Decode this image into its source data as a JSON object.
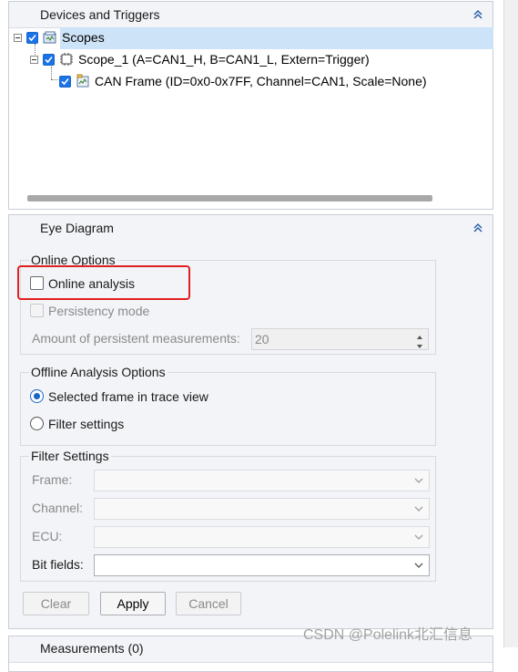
{
  "devices_panel": {
    "title": "Devices and Triggers",
    "tree": {
      "root_label": "Scopes",
      "scope_label": "Scope_1 (A=CAN1_H, B=CAN1_L, Extern=Trigger)",
      "frame_label": "CAN Frame (ID=0x0-0x7FF, Channel=CAN1, Scale=None)"
    }
  },
  "eye_panel": {
    "title": "Eye Diagram",
    "online": {
      "group_label": "Online Options",
      "online_analysis_label": "Online analysis",
      "persistency_label": "Persistency mode",
      "amount_label": "Amount of persistent measurements:",
      "amount_value": "20"
    },
    "offline": {
      "group_label": "Offline Analysis Options",
      "option_selected_frame": "Selected frame in trace view",
      "option_filter_settings": "Filter settings"
    },
    "filter": {
      "group_label": "Filter Settings",
      "frame_label": "Frame:",
      "channel_label": "Channel:",
      "ecu_label": "ECU:",
      "bitfields_label": "Bit fields:"
    },
    "buttons": {
      "clear": "Clear",
      "apply": "Apply",
      "cancel": "Cancel"
    }
  },
  "measurements_panel": {
    "title": "Measurements (0)"
  },
  "watermark": "CSDN @Polelink北汇信息",
  "colors": {
    "accent": "#1a73e8",
    "highlight_box": "#e02020",
    "selection": "#cde3f7"
  }
}
